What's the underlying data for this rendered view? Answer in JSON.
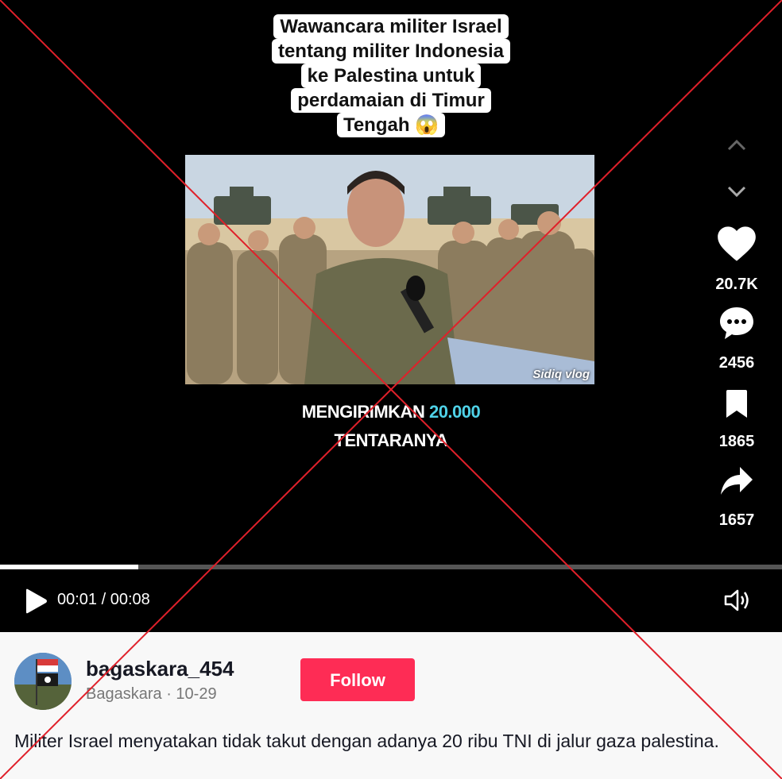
{
  "caption": {
    "lines": [
      "Wawancara militer Israel",
      "tentang militer Indonesia",
      "ke Palestina untuk",
      "perdamaian di Timur",
      "Tengah 😱"
    ]
  },
  "video": {
    "watermark": "Sidiq vlog",
    "subtitle_line1_prefix": "MENGIRIMKAN ",
    "subtitle_line1_highlight": "20.000",
    "subtitle_line2": "TENTARANYA"
  },
  "side": {
    "likes": "20.7K",
    "comments": "2456",
    "saves": "1865",
    "shares": "1657"
  },
  "player": {
    "time": "00:01 / 00:08",
    "progress": 0.177
  },
  "author": {
    "username": "bagaskara_454",
    "display_name": "Bagaskara",
    "date": "10-29",
    "separator": "·",
    "follow_label": "Follow"
  },
  "description": "Militer Israel menyatakan tidak takut dengan adanya 20 ribu TNI di jalur gaza palestina.",
  "colors": {
    "follow_bg": "#fe2c55",
    "cross": "#e0202a",
    "subtitle_highlight": "#4fd2e8"
  }
}
